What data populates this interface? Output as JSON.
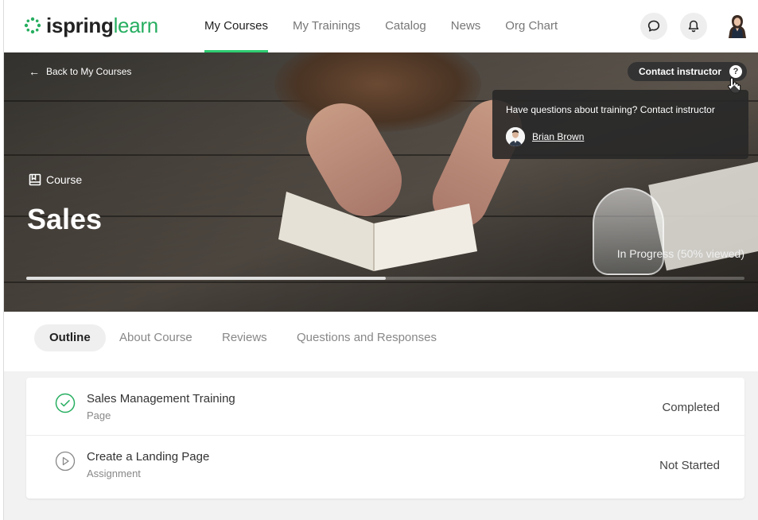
{
  "header": {
    "logo": {
      "brand": "ispring",
      "product": "learn"
    },
    "nav": [
      {
        "label": "My Courses",
        "active": true
      },
      {
        "label": "My Trainings",
        "active": false
      },
      {
        "label": "Catalog",
        "active": false
      },
      {
        "label": "News",
        "active": false
      },
      {
        "label": "Org Chart",
        "active": false
      }
    ],
    "icons": {
      "messages": "chat-bubble-icon",
      "notifications": "bell-icon",
      "profile": "user-avatar"
    }
  },
  "hero": {
    "back_label": "Back to My Courses",
    "contact_label": "Contact instructor",
    "help_glyph": "?",
    "popover": {
      "title": "Have questions about training? Contact instructor",
      "instructor": "Brian Brown"
    },
    "course_type": "Course",
    "title": "Sales",
    "progress_text": "In Progress (50% viewed)",
    "progress_fraction": 0.5
  },
  "tabs": [
    {
      "label": "Outline",
      "active": true
    },
    {
      "label": "About Course",
      "active": false
    },
    {
      "label": "Reviews",
      "active": false
    },
    {
      "label": "Questions and Responses",
      "active": false
    }
  ],
  "outline": [
    {
      "title": "Sales Management Training",
      "type": "Page",
      "status": "Completed",
      "icon": "check-circle-icon"
    },
    {
      "title": "Create a Landing Page",
      "type": "Assignment",
      "status": "Not Started",
      "icon": "play-circle-icon"
    }
  ],
  "colors": {
    "accent": "#2ecc71",
    "popover_bg": "#282828",
    "page_bg": "#f2f2f2"
  }
}
